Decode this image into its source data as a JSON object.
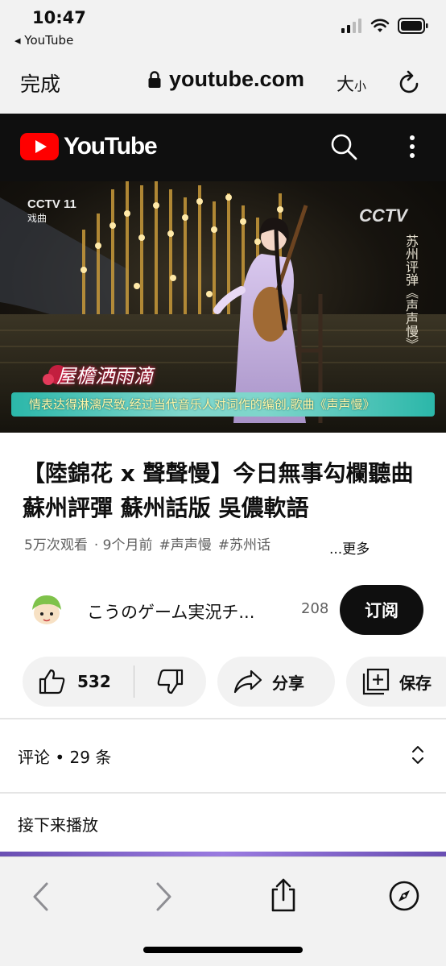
{
  "status_bar": {
    "time": "10:47",
    "back_app": "◂ YouTube"
  },
  "address_bar": {
    "done_label": "完成",
    "url": "youtube.com",
    "text_size_big": "大",
    "text_size_small": "小"
  },
  "yt_header": {
    "logo_text": "YouTube"
  },
  "video": {
    "channel_logo_left": "CCTV 11",
    "channel_logo_left_sub": "戏曲",
    "channel_logo_right": "CCTV",
    "vertical_caption": "苏州评弹《声声慢》",
    "title_overlay": "屋檐洒雨滴",
    "lyric_line": "情表达得淋漓尽致,经过当代音乐人对词作的编创,歌曲《声声慢》"
  },
  "info": {
    "title": "【陸錦花 x 聲聲慢】今日無事勾欄聽曲 蘇州評彈 蘇州話版 吳儂軟語",
    "views": "5万次观看",
    "age": "· 9个月前",
    "tags": [
      "#声声慢",
      "#苏州话"
    ],
    "more": "...更多"
  },
  "channel": {
    "name": "こうのゲーム実況チ...",
    "subscribers": "208",
    "subscribe_label": "订阅"
  },
  "actions": {
    "likes": "532",
    "share_label": "分享",
    "save_label": "保存"
  },
  "comments": {
    "label": "评论 • 29 条"
  },
  "up_next": {
    "label": "接下来播放"
  },
  "icons": [
    "signal-icon",
    "wifi-icon",
    "battery-icon",
    "lock-icon",
    "reload-icon",
    "search-icon",
    "more-vert-icon",
    "like-icon",
    "dislike-icon",
    "share-icon",
    "save-icon",
    "expand-icon",
    "back-icon",
    "forward-icon",
    "share-sheet-icon",
    "compass-icon"
  ],
  "colors": {
    "youtube_red": "#ff0000",
    "header_bg": "#0f0f0f",
    "pill_bg": "#f2f2f2"
  }
}
